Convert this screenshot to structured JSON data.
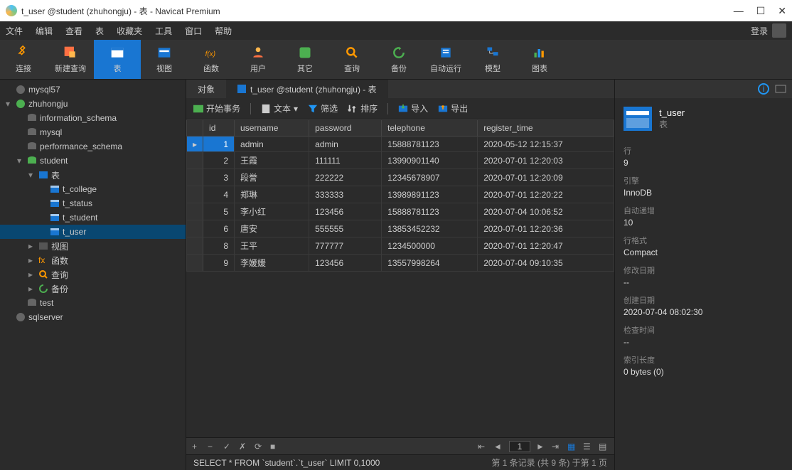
{
  "title": "t_user @student (zhuhongju) - 表 - Navicat Premium",
  "menu": [
    "文件",
    "编辑",
    "查看",
    "表",
    "收藏夹",
    "工具",
    "窗口",
    "帮助"
  ],
  "login": "登录",
  "toolbar": [
    {
      "label": "连接",
      "icon": "plug"
    },
    {
      "label": "新建查询",
      "icon": "newquery"
    },
    {
      "label": "表",
      "icon": "table",
      "active": true
    },
    {
      "label": "视图",
      "icon": "view"
    },
    {
      "label": "函数",
      "icon": "fx"
    },
    {
      "label": "用户",
      "icon": "user"
    },
    {
      "label": "其它",
      "icon": "other"
    },
    {
      "label": "查询",
      "icon": "query"
    },
    {
      "label": "备份",
      "icon": "backup"
    },
    {
      "label": "自动运行",
      "icon": "auto"
    },
    {
      "label": "模型",
      "icon": "model"
    },
    {
      "label": "图表",
      "icon": "chart"
    }
  ],
  "tree": [
    {
      "label": "mysql57",
      "level": 0,
      "icon": "server-off"
    },
    {
      "label": "zhuhongju",
      "level": 0,
      "icon": "server-on",
      "open": true
    },
    {
      "label": "information_schema",
      "level": 1,
      "icon": "db"
    },
    {
      "label": "mysql",
      "level": 1,
      "icon": "db"
    },
    {
      "label": "performance_schema",
      "level": 1,
      "icon": "db"
    },
    {
      "label": "student",
      "level": 1,
      "icon": "db-on",
      "open": true
    },
    {
      "label": "表",
      "level": 2,
      "icon": "tables",
      "open": true
    },
    {
      "label": "t_college",
      "level": 3,
      "icon": "table"
    },
    {
      "label": "t_status",
      "level": 3,
      "icon": "table"
    },
    {
      "label": "t_student",
      "level": 3,
      "icon": "table"
    },
    {
      "label": "t_user",
      "level": 3,
      "icon": "table",
      "sel": true
    },
    {
      "label": "视图",
      "level": 2,
      "icon": "views",
      "closed": true
    },
    {
      "label": "函数",
      "level": 2,
      "icon": "fx",
      "closed": true
    },
    {
      "label": "查询",
      "level": 2,
      "icon": "query",
      "closed": true
    },
    {
      "label": "备份",
      "level": 2,
      "icon": "backup",
      "closed": true
    },
    {
      "label": "test",
      "level": 1,
      "icon": "db"
    },
    {
      "label": "sqlserver",
      "level": 0,
      "icon": "server-off"
    }
  ],
  "tabs": [
    {
      "label": "对象",
      "active": false
    },
    {
      "label": "t_user @student (zhuhongju) - 表",
      "active": true
    }
  ],
  "subtool": {
    "begin": "开始事务",
    "text": "文本",
    "filter": "筛选",
    "sort": "排序",
    "import": "导入",
    "export": "导出"
  },
  "columns": [
    "id",
    "username",
    "password",
    "telephone",
    "register_time"
  ],
  "rows": [
    {
      "id": "1",
      "username": "admin",
      "password": "admin",
      "telephone": "15888781123",
      "register_time": "2020-05-12 12:15:37",
      "sel": true
    },
    {
      "id": "2",
      "username": "王霞",
      "password": "111111",
      "telephone": "13990901140",
      "register_time": "2020-07-01 12:20:03"
    },
    {
      "id": "3",
      "username": "段誉",
      "password": "222222",
      "telephone": "12345678907",
      "register_time": "2020-07-01 12:20:09"
    },
    {
      "id": "4",
      "username": "郑琳",
      "password": "333333",
      "telephone": "13989891123",
      "register_time": "2020-07-01 12:20:22"
    },
    {
      "id": "5",
      "username": "李小红",
      "password": "123456",
      "telephone": "15888781123",
      "register_time": "2020-07-04 10:06:52"
    },
    {
      "id": "6",
      "username": "唐安",
      "password": "555555",
      "telephone": "13853452232",
      "register_time": "2020-07-01 12:20:36"
    },
    {
      "id": "8",
      "username": "王平",
      "password": "777777",
      "telephone": "1234500000",
      "register_time": "2020-07-01 12:20:47"
    },
    {
      "id": "9",
      "username": "李媛媛",
      "password": "123456",
      "telephone": "13557998264",
      "register_time": "2020-07-04 09:10:35"
    }
  ],
  "page_no": "1",
  "sql": "SELECT * FROM `student`.`t_user` LIMIT 0,1000",
  "status_right": "第 1 条记录 (共 9 条) 于第 1 页",
  "panel": {
    "name": "t_user",
    "type": "表",
    "props": [
      {
        "k": "行",
        "v": "9"
      },
      {
        "k": "引擎",
        "v": "InnoDB"
      },
      {
        "k": "自动递增",
        "v": "10"
      },
      {
        "k": "行格式",
        "v": "Compact"
      },
      {
        "k": "修改日期",
        "v": "--"
      },
      {
        "k": "创建日期",
        "v": "2020-07-04 08:02:30"
      },
      {
        "k": "检查时间",
        "v": "--"
      },
      {
        "k": "索引长度",
        "v": "0 bytes (0)"
      }
    ]
  }
}
